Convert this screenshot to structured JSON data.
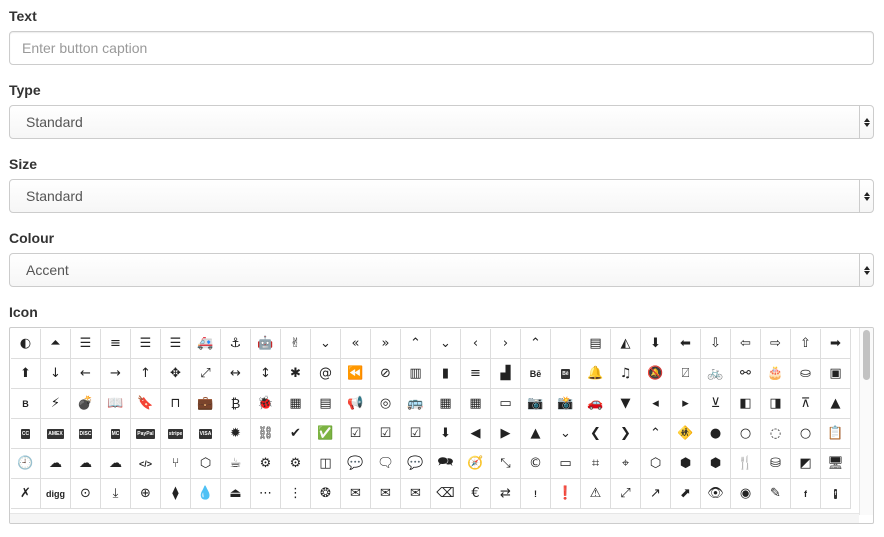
{
  "form": {
    "text": {
      "label": "Text",
      "placeholder": "Enter button caption",
      "value": ""
    },
    "type": {
      "label": "Type",
      "selected": "Standard"
    },
    "size": {
      "label": "Size",
      "selected": "Standard"
    },
    "colour": {
      "label": "Colour",
      "selected": "Accent"
    },
    "icon": {
      "label": "Icon"
    }
  },
  "icons": [
    {
      "name": "adjust-icon",
      "glyph": "◐"
    },
    {
      "name": "chevron-circle-up-icon",
      "glyph": "⏶"
    },
    {
      "name": "align-center-icon",
      "glyph": "☰"
    },
    {
      "name": "align-justify-icon",
      "glyph": "≡"
    },
    {
      "name": "align-left-icon",
      "glyph": "☰"
    },
    {
      "name": "align-right-icon",
      "glyph": "☰"
    },
    {
      "name": "ambulance-icon",
      "glyph": "🚑"
    },
    {
      "name": "anchor-icon",
      "glyph": "⚓"
    },
    {
      "name": "android-icon",
      "glyph": "🤖"
    },
    {
      "name": "angellist-icon",
      "glyph": "✌"
    },
    {
      "name": "angle-double-down-icon",
      "glyph": "⌄"
    },
    {
      "name": "angle-double-left-icon",
      "glyph": "«"
    },
    {
      "name": "angle-double-right-icon",
      "glyph": "»"
    },
    {
      "name": "angle-double-up-icon",
      "glyph": "⌃"
    },
    {
      "name": "angle-down-icon",
      "glyph": "⌄"
    },
    {
      "name": "angle-left-icon",
      "glyph": "‹"
    },
    {
      "name": "angle-right-icon",
      "glyph": "›"
    },
    {
      "name": "angle-up-icon",
      "glyph": "⌃"
    },
    {
      "name": "apple-icon",
      "glyph": ""
    },
    {
      "name": "archive-icon",
      "glyph": "▤"
    },
    {
      "name": "area-chart-icon",
      "glyph": "◭"
    },
    {
      "name": "arrow-circle-down-icon",
      "glyph": "⬇"
    },
    {
      "name": "arrow-circle-left-icon",
      "glyph": "⬅"
    },
    {
      "name": "arrow-circle-o-down-icon",
      "glyph": "⇩"
    },
    {
      "name": "arrow-circle-o-left-icon",
      "glyph": "⇦"
    },
    {
      "name": "arrow-circle-o-right-icon",
      "glyph": "⇨"
    },
    {
      "name": "arrow-circle-o-up-icon",
      "glyph": "⇧"
    },
    {
      "name": "arrow-circle-right-icon",
      "glyph": "➡"
    },
    {
      "name": "arrow-circle-up-icon",
      "glyph": "⬆"
    },
    {
      "name": "arrow-down-icon",
      "glyph": "↓"
    },
    {
      "name": "arrow-left-icon",
      "glyph": "←"
    },
    {
      "name": "arrow-right-icon",
      "glyph": "→"
    },
    {
      "name": "arrow-up-icon",
      "glyph": "↑"
    },
    {
      "name": "arrows-icon",
      "glyph": "✥"
    },
    {
      "name": "arrows-alt-icon",
      "glyph": "⤢"
    },
    {
      "name": "arrows-h-icon",
      "glyph": "↔"
    },
    {
      "name": "arrows-v-icon",
      "glyph": "↕"
    },
    {
      "name": "asterisk-icon",
      "glyph": "✱"
    },
    {
      "name": "at-icon",
      "glyph": "@"
    },
    {
      "name": "backward-icon",
      "glyph": "⏪"
    },
    {
      "name": "ban-icon",
      "glyph": "⊘"
    },
    {
      "name": "bar-chart-icon",
      "glyph": "▥"
    },
    {
      "name": "barcode-icon",
      "glyph": "▮"
    },
    {
      "name": "bars-icon",
      "glyph": "≡"
    },
    {
      "name": "bed-icon",
      "glyph": "▟"
    },
    {
      "name": "behance-icon",
      "glyph": "Bē",
      "type": "txt"
    },
    {
      "name": "behance-square-icon",
      "glyph": "Bē",
      "type": "box"
    },
    {
      "name": "bell-icon",
      "glyph": "🔔"
    },
    {
      "name": "bell-o-icon",
      "glyph": "♫"
    },
    {
      "name": "bell-slash-icon",
      "glyph": "🔕"
    },
    {
      "name": "bell-slash-o-icon",
      "glyph": "⍁"
    },
    {
      "name": "bicycle-icon",
      "glyph": "🚲"
    },
    {
      "name": "binoculars-icon",
      "glyph": "⚯"
    },
    {
      "name": "birthday-cake-icon",
      "glyph": "🎂"
    },
    {
      "name": "bitbucket-icon",
      "glyph": "⛀"
    },
    {
      "name": "bitbucket-square-icon",
      "glyph": "▣"
    },
    {
      "name": "bold-icon",
      "glyph": "B",
      "type": "txt"
    },
    {
      "name": "bolt-icon",
      "glyph": "⚡"
    },
    {
      "name": "bomb-icon",
      "glyph": "💣"
    },
    {
      "name": "book-icon",
      "glyph": "📖"
    },
    {
      "name": "bookmark-icon",
      "glyph": "🔖"
    },
    {
      "name": "bookmark-o-icon",
      "glyph": "⊓"
    },
    {
      "name": "briefcase-icon",
      "glyph": "💼"
    },
    {
      "name": "btc-icon",
      "glyph": "₿"
    },
    {
      "name": "bug-icon",
      "glyph": "🐞"
    },
    {
      "name": "building-icon",
      "glyph": "▦"
    },
    {
      "name": "building-o-icon",
      "glyph": "▤"
    },
    {
      "name": "bullhorn-icon",
      "glyph": "📢"
    },
    {
      "name": "bullseye-icon",
      "glyph": "◎"
    },
    {
      "name": "bus-icon",
      "glyph": "🚌"
    },
    {
      "name": "calculator-icon",
      "glyph": "▦"
    },
    {
      "name": "calendar-icon",
      "glyph": "▦"
    },
    {
      "name": "calendar-o-icon",
      "glyph": "▭"
    },
    {
      "name": "camera-icon",
      "glyph": "📷"
    },
    {
      "name": "camera-retro-icon",
      "glyph": "📸"
    },
    {
      "name": "car-icon",
      "glyph": "🚗"
    },
    {
      "name": "caret-down-icon",
      "glyph": "▼"
    },
    {
      "name": "caret-left-icon",
      "glyph": "◂"
    },
    {
      "name": "caret-right-icon",
      "glyph": "▸"
    },
    {
      "name": "caret-square-o-down-icon",
      "glyph": "⊻"
    },
    {
      "name": "caret-square-o-left-icon",
      "glyph": "◧"
    },
    {
      "name": "caret-square-o-right-icon",
      "glyph": "◨"
    },
    {
      "name": "caret-square-o-up-icon",
      "glyph": "⊼"
    },
    {
      "name": "caret-up-icon",
      "glyph": "▲"
    },
    {
      "name": "cc-icon",
      "glyph": "CC",
      "type": "box"
    },
    {
      "name": "cc-amex-icon",
      "glyph": "AMEX",
      "type": "box"
    },
    {
      "name": "cc-discover-icon",
      "glyph": "DISC",
      "type": "box"
    },
    {
      "name": "cc-mastercard-icon",
      "glyph": "MC",
      "type": "box"
    },
    {
      "name": "cc-paypal-icon",
      "glyph": "PayPal",
      "type": "box"
    },
    {
      "name": "cc-stripe-icon",
      "glyph": "stripe",
      "type": "box"
    },
    {
      "name": "cc-visa-icon",
      "glyph": "VISA",
      "type": "box"
    },
    {
      "name": "certificate-icon",
      "glyph": "✹"
    },
    {
      "name": "chain-broken-icon",
      "glyph": "⛓"
    },
    {
      "name": "check-icon",
      "glyph": "✔"
    },
    {
      "name": "check-circle-icon",
      "glyph": "✅"
    },
    {
      "name": "check-circle-o-icon",
      "glyph": "☑"
    },
    {
      "name": "check-square-icon",
      "glyph": "☑"
    },
    {
      "name": "check-square-o-icon",
      "glyph": "☑"
    },
    {
      "name": "chevron-circle-down-icon",
      "glyph": "⬇"
    },
    {
      "name": "chevron-circle-left-icon",
      "glyph": "◀"
    },
    {
      "name": "chevron-circle-right-icon",
      "glyph": "▶"
    },
    {
      "name": "chevron-circle-up-icon",
      "glyph": "▲"
    },
    {
      "name": "chevron-down-icon",
      "glyph": "⌄"
    },
    {
      "name": "chevron-left-icon",
      "glyph": "❮"
    },
    {
      "name": "chevron-right-icon",
      "glyph": "❯"
    },
    {
      "name": "chevron-up-icon",
      "glyph": "⌃"
    },
    {
      "name": "child-icon",
      "glyph": "🚸"
    },
    {
      "name": "circle-icon",
      "glyph": "●"
    },
    {
      "name": "circle-o-icon",
      "glyph": "○"
    },
    {
      "name": "circle-o-notch-icon",
      "glyph": "◌"
    },
    {
      "name": "circle-thin-icon",
      "glyph": "○"
    },
    {
      "name": "clipboard-icon",
      "glyph": "📋"
    },
    {
      "name": "clock-o-icon",
      "glyph": "🕘"
    },
    {
      "name": "cloud-icon",
      "glyph": "☁"
    },
    {
      "name": "cloud-download-icon",
      "glyph": "☁"
    },
    {
      "name": "cloud-upload-icon",
      "glyph": "☁"
    },
    {
      "name": "code-icon",
      "glyph": "</>",
      "type": "txt"
    },
    {
      "name": "code-fork-icon",
      "glyph": "⑂"
    },
    {
      "name": "codepen-icon",
      "glyph": "⬡"
    },
    {
      "name": "coffee-icon",
      "glyph": "☕"
    },
    {
      "name": "cog-icon",
      "glyph": "⚙"
    },
    {
      "name": "cogs-icon",
      "glyph": "⚙"
    },
    {
      "name": "columns-icon",
      "glyph": "◫"
    },
    {
      "name": "comment-icon",
      "glyph": "💬"
    },
    {
      "name": "comment-o-icon",
      "glyph": "🗨"
    },
    {
      "name": "comments-icon",
      "glyph": "💬"
    },
    {
      "name": "comments-o-icon",
      "glyph": "🗪"
    },
    {
      "name": "compass-icon",
      "glyph": "🧭"
    },
    {
      "name": "compress-icon",
      "glyph": "⤡"
    },
    {
      "name": "copyright-icon",
      "glyph": "©"
    },
    {
      "name": "credit-card-icon",
      "glyph": "▭"
    },
    {
      "name": "crop-icon",
      "glyph": "⌗"
    },
    {
      "name": "crosshairs-icon",
      "glyph": "⌖"
    },
    {
      "name": "css3-icon",
      "glyph": "⬡"
    },
    {
      "name": "cube-icon",
      "glyph": "⬢"
    },
    {
      "name": "cubes-icon",
      "glyph": "⬢"
    },
    {
      "name": "cutlery-icon",
      "glyph": "🍴"
    },
    {
      "name": "database-icon",
      "glyph": "⛁"
    },
    {
      "name": "delicious-icon",
      "glyph": "◩"
    },
    {
      "name": "desktop-icon",
      "glyph": "🖥"
    },
    {
      "name": "deviantart-icon",
      "glyph": "✗"
    },
    {
      "name": "digg-icon",
      "glyph": "digg",
      "type": "txt"
    },
    {
      "name": "dot-circle-o-icon",
      "glyph": "⊙"
    },
    {
      "name": "download-icon",
      "glyph": "⤓"
    },
    {
      "name": "dribbble-icon",
      "glyph": "⊕"
    },
    {
      "name": "dropbox-icon",
      "glyph": "⧫"
    },
    {
      "name": "drupal-icon",
      "glyph": "💧"
    },
    {
      "name": "eject-icon",
      "glyph": "⏏"
    },
    {
      "name": "ellipsis-h-icon",
      "glyph": "⋯"
    },
    {
      "name": "ellipsis-v-icon",
      "glyph": "⋮"
    },
    {
      "name": "empire-icon",
      "glyph": "❂"
    },
    {
      "name": "envelope-icon",
      "glyph": "✉"
    },
    {
      "name": "envelope-o-icon",
      "glyph": "✉"
    },
    {
      "name": "envelope-square-icon",
      "glyph": "✉"
    },
    {
      "name": "eraser-icon",
      "glyph": "⌫"
    },
    {
      "name": "eur-icon",
      "glyph": "€"
    },
    {
      "name": "exchange-icon",
      "glyph": "⇄"
    },
    {
      "name": "exclamation-icon",
      "glyph": "!",
      "type": "txt"
    },
    {
      "name": "exclamation-circle-icon",
      "glyph": "❗"
    },
    {
      "name": "exclamation-triangle-icon",
      "glyph": "⚠"
    },
    {
      "name": "expand-icon",
      "glyph": "⤢"
    },
    {
      "name": "external-link-icon",
      "glyph": "↗"
    },
    {
      "name": "external-link-square-icon",
      "glyph": "⬈"
    },
    {
      "name": "eye-icon",
      "glyph": "👁"
    },
    {
      "name": "eye-slash-icon",
      "glyph": "◉"
    },
    {
      "name": "eyedropper-icon",
      "glyph": "✎"
    },
    {
      "name": "facebook-icon",
      "glyph": "f",
      "type": "txt"
    },
    {
      "name": "facebook-square-icon",
      "glyph": "f",
      "type": "box"
    }
  ]
}
